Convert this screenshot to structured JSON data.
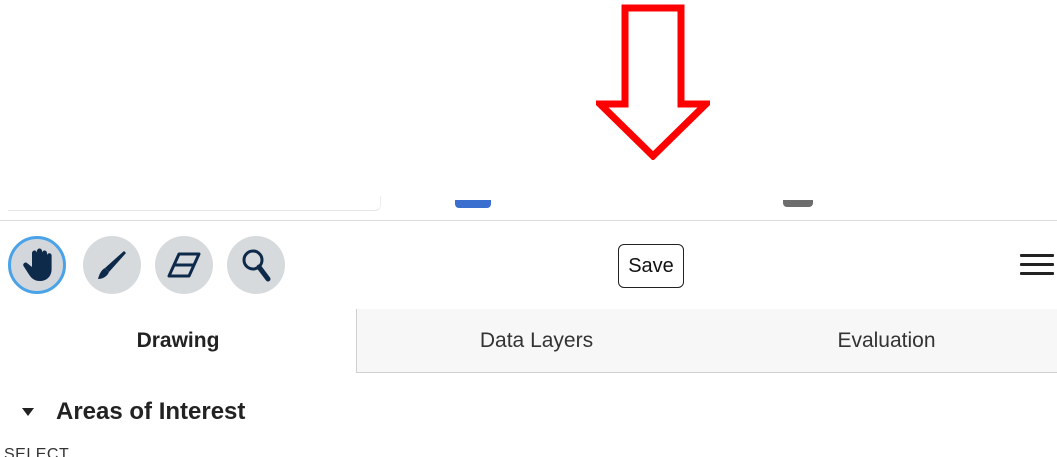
{
  "annotation": {
    "color": "#ff0000",
    "icon": "red-down-arrow-icon"
  },
  "toolbar": {
    "tools": [
      {
        "name": "pan",
        "icon": "hand-icon",
        "active": true
      },
      {
        "name": "draw",
        "icon": "pen-icon",
        "active": false
      },
      {
        "name": "erase",
        "icon": "eraser-icon",
        "active": false
      },
      {
        "name": "zoom",
        "icon": "magnifier-icon",
        "active": false
      }
    ],
    "save_label": "Save",
    "menu_icon": "hamburger-menu-icon",
    "active_ring_color": "#4aa3e8",
    "tool_bg_color": "#d7dadd",
    "icon_color": "#0e2a4a"
  },
  "tabs": [
    {
      "label": "Drawing",
      "active": true
    },
    {
      "label": "Data Layers",
      "active": false
    },
    {
      "label": "Evaluation",
      "active": false
    }
  ],
  "section": {
    "title": "Areas of Interest",
    "expanded": true,
    "next_label_partial": "SELECT"
  }
}
